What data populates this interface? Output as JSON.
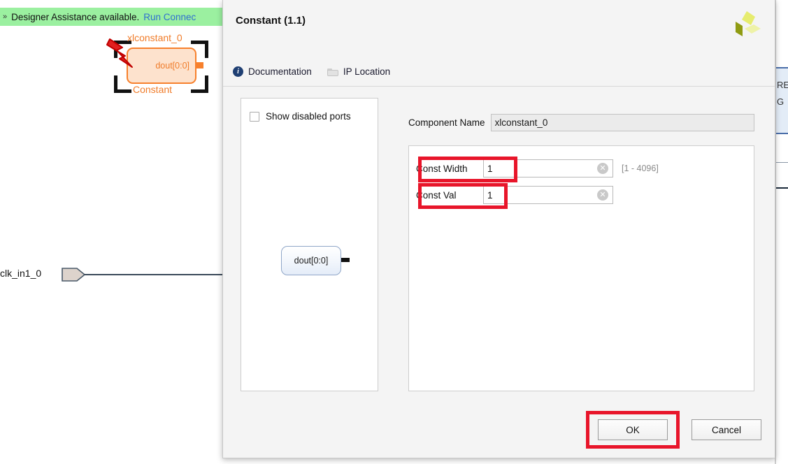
{
  "canvas": {
    "banner": {
      "chevron": "»",
      "text": "Designer Assistance available.",
      "link": "Run Connec"
    },
    "const_block": {
      "instance_label": "xlconstant_0",
      "port_label": "dout[0:0]",
      "type_label": "Constant"
    },
    "external_port": {
      "label": "clk_in1_0"
    },
    "right_block": {
      "line1": "RE",
      "line2": "G"
    }
  },
  "dialog": {
    "title": "Constant (1.1)",
    "logo_name": "xilinx-logo",
    "toolbar": {
      "documentation_label": "Documentation",
      "documentation_icon": "info-icon",
      "ip_location_label": "IP Location",
      "ip_location_icon": "folder-icon"
    },
    "left_panel": {
      "show_disabled_ports_label": "Show disabled ports",
      "show_disabled_ports_checked": false,
      "symbol_port_label": "dout[0:0]"
    },
    "component_name": {
      "label": "Component Name",
      "value": "xlconstant_0"
    },
    "parameters": [
      {
        "label": "Const Width",
        "value": "1",
        "range": "[1 - 4096]",
        "clear_icon": "✕"
      },
      {
        "label": "Const Val",
        "value": "1",
        "range": "",
        "clear_icon": "✕"
      }
    ],
    "buttons": {
      "ok": "OK",
      "cancel": "Cancel"
    }
  },
  "annotations": {
    "highlight_color": "#e8152a",
    "boxes": [
      "const-width-field",
      "const-val-field",
      "ok-button"
    ],
    "arrow": "lightning-bolt-pointer"
  }
}
